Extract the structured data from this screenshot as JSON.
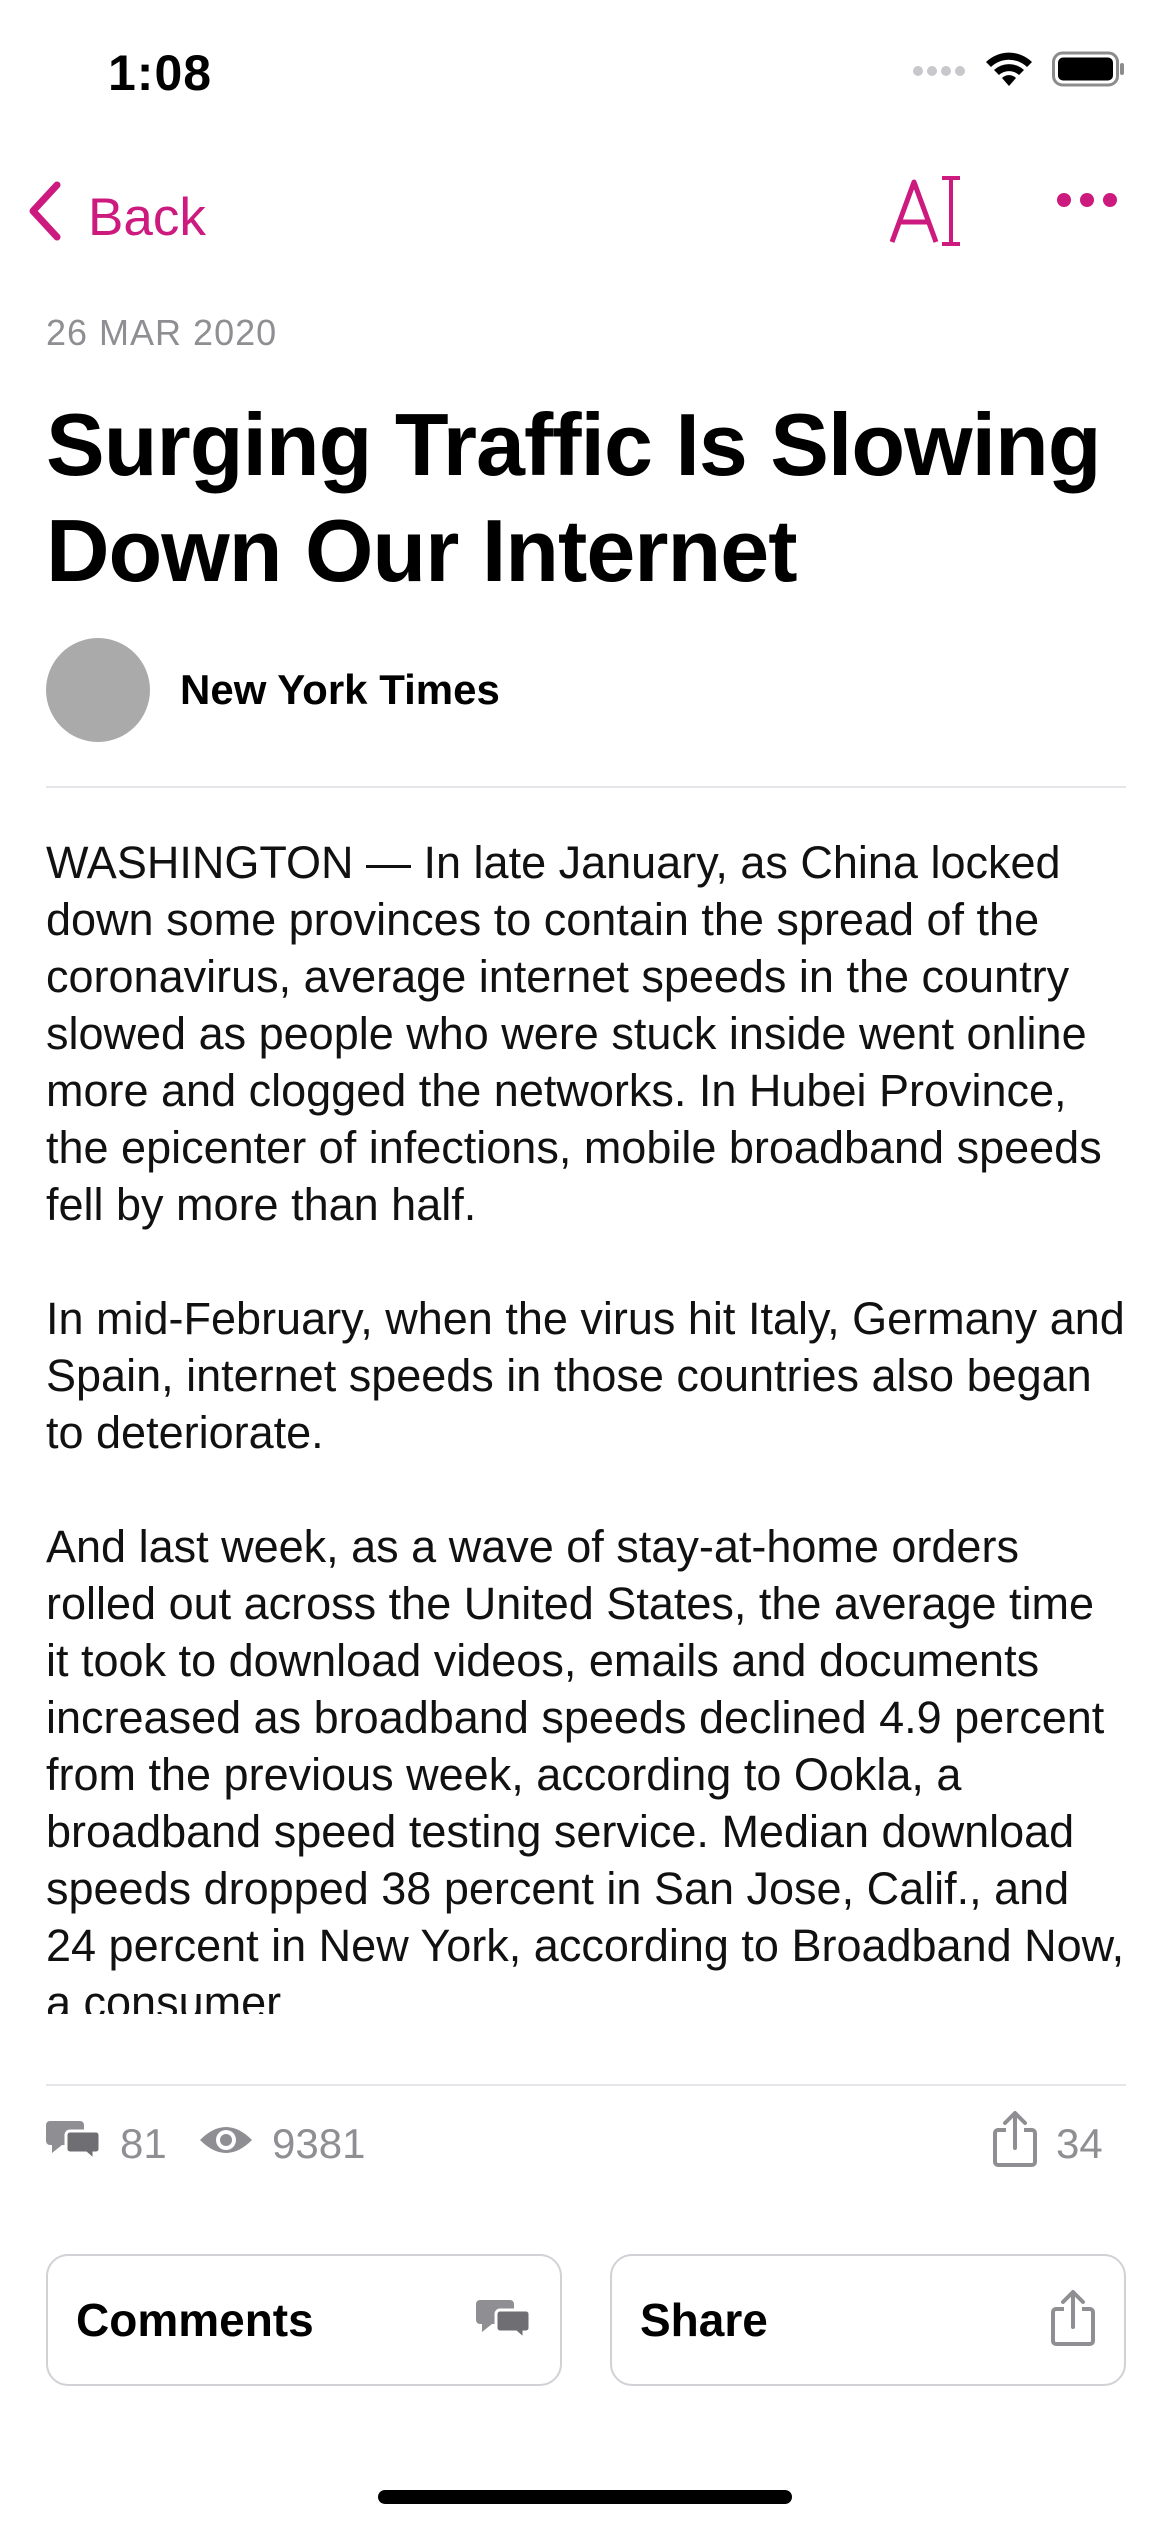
{
  "status_bar": {
    "time": "1:08"
  },
  "nav": {
    "back_label": "Back",
    "accent_color": "#CC1A7F",
    "text_size_icon": "text-size-icon",
    "more_icon": "more-icon"
  },
  "article": {
    "date": "26 MAR 2020",
    "title": "Surging Traffic Is Slowing Down Our Internet",
    "source": "New York Times",
    "paragraphs": [
      "WASHINGTON — In late January, as China locked down some provinces to contain the spread of the coronavirus, average internet speeds in the country slowed as people who were stuck inside went online more and clogged the networks. In Hubei Province, the epicenter of infections, mobile broadband speeds fell by more than half.",
      "In mid-February, when the virus hit Italy, Germany and Spain, internet speeds in those countries also began to deteriorate.",
      "And last week, as a wave of stay-at-home orders rolled out across the United States, the average time it took to download videos, emails and documents increased as broadband speeds declined 4.9 percent from the previous week, according to Ookla, a broadband speed testing service. Median download speeds dropped 38 percent in San Jose, Calif., and 24 percent in New York, according to Broadband Now, a consumer"
    ]
  },
  "stats": {
    "comments": "81",
    "views": "9381",
    "shares": "34"
  },
  "actions": {
    "comments_label": "Comments",
    "share_label": "Share"
  }
}
